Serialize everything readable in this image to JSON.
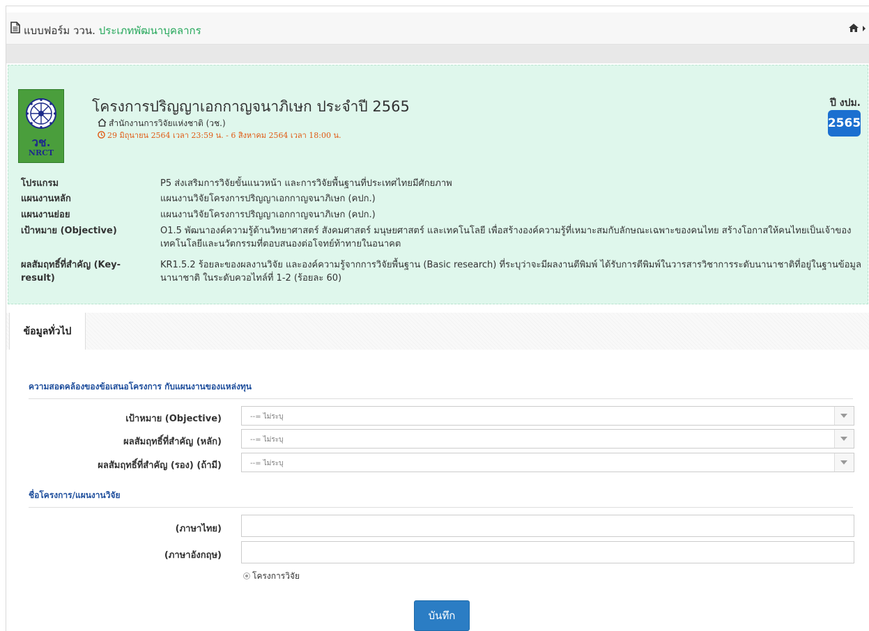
{
  "header": {
    "title_prefix": "แบบฟอร์ม ววน.",
    "title_accent": "ประเภทพัฒนาบุคลากร"
  },
  "project": {
    "logo_th": "วช.",
    "logo_en": "NRCT",
    "title": "โครงการปริญญาเอกกาญจนาภิเษก ประจำปี 2565",
    "agency": "สำนักงานการวิจัยแห่งชาติ (วช.)",
    "period": "29 มิถุนายน 2564 เวลา 23:59 น. - 6 สิงหาคม 2564 เวลา 18:00 น.",
    "fiscal_year_label": "ปี งปม.",
    "fiscal_year": "2565"
  },
  "details": [
    {
      "label": "โปรแกรม",
      "value": "P5 ส่งเสริมการวิจัยขั้นแนวหน้า และการวิจัยพื้นฐานที่ประเทศไทยมีศักยภาพ"
    },
    {
      "label": "แผนงานหลัก",
      "value": "แผนงานวิจัยโครงการปริญญาเอกกาญจนาภิเษก (คปก.)"
    },
    {
      "label": "แผนงานย่อย",
      "value": "แผนงานวิจัยโครงการปริญญาเอกกาญจนาภิเษก (คปก.)"
    },
    {
      "label": "เป้าหมาย (Objective)",
      "value": "O1.5 พัฒนาองค์ความรู้ด้านวิทยาศาสตร์ สังคมศาสตร์ มนุษยศาสตร์ และเทคโนโลยี เพื่อสร้างองค์ความรู้ที่เหมาะสมกับลักษณะเฉพาะของคนไทย สร้างโอกาสให้คนไทยเป็นเจ้าของเทคโนโลยีและนวัตกรรมที่ตอบสนองต่อโจทย์ท้าทายในอนาคต"
    },
    {
      "label": "ผลสัมฤทธิ์ที่สำคัญ (Key-result)",
      "value": "KR1.5.2 ร้อยละของผลงานวิจัย และองค์ความรู้จากการวิจัยพื้นฐาน (Basic research) ที่ระบุว่าจะมีผลงานตีพิมพ์ ได้รับการตีพิมพ์ในวารสารวิชาการระดับนานาชาติที่อยู่ในฐานข้อมูลนานาชาติ ในระดับควอไทล์ที่ 1-2 (ร้อยละ 60)"
    }
  ],
  "tabs": {
    "general": "ข้อมูลทั่วไป"
  },
  "form": {
    "alignment_heading": "ความสอดคล้องของข้อเสนอโครงการ กับแผนงานของแหล่งทุน",
    "objective_label": "เป้าหมาย (Objective)",
    "kr_main_label": "ผลสัมฤทธิ์ที่สำคัญ (หลัก)",
    "kr_sub_label": "ผลสัมฤทธิ์ที่สำคัญ (รอง) (ถ้ามี)",
    "select_placeholder": "--= ไม่ระบุ",
    "name_heading": "ชื่อโครงการ/แผนงานวิจัย",
    "thai_label": "(ภาษาไทย)",
    "english_label": "(ภาษาอังกฤษ)",
    "thai_value": "",
    "english_value": "",
    "radio_label": "โครงการวิจัย",
    "save_label": "บันทึก"
  },
  "colors": {
    "accent_green": "#27a85c",
    "panel_bg": "#dff7ec",
    "badge_blue": "#1b6fd0",
    "date_orange": "#e05a13",
    "section_blue": "#1e4e9c",
    "button_blue": "#2b7dc4"
  },
  "icons": [
    "file-text-icon",
    "home-icon",
    "house-outline-icon",
    "clock-icon",
    "chevron-down-icon",
    "radio-icon"
  ]
}
